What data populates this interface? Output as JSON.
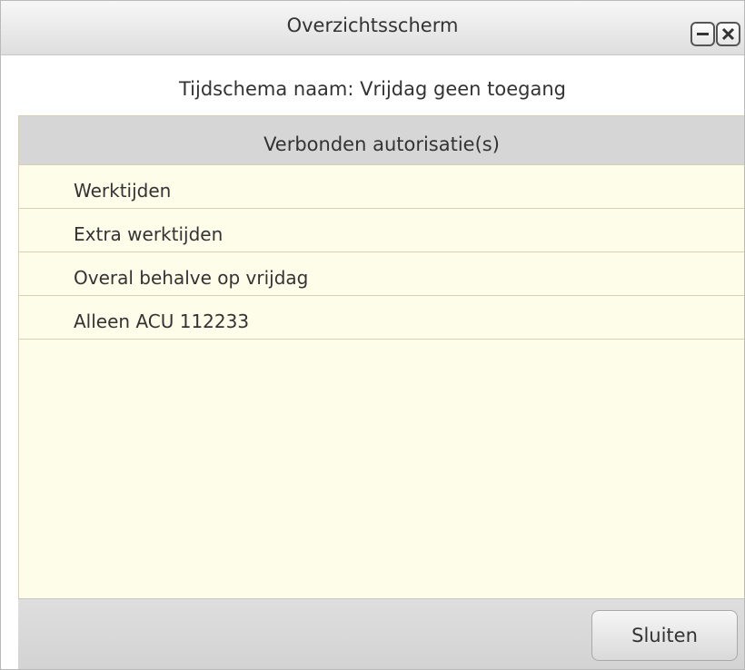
{
  "window": {
    "title": "Overzichtsscherm"
  },
  "schedule": {
    "label": "Tijdschema naam: Vrijdag geen toegang"
  },
  "list": {
    "header": "Verbonden autorisatie(s)",
    "items": [
      {
        "label": "Werktijden"
      },
      {
        "label": "Extra werktijden"
      },
      {
        "label": "Overal behalve op vrijdag"
      },
      {
        "label": "Alleen ACU 112233"
      }
    ]
  },
  "footer": {
    "close_label": "Sluiten"
  },
  "colors": {
    "list_background": "#fefdea",
    "header_background": "#d6d6d6",
    "titlebar_background": "#e6e6e6"
  }
}
